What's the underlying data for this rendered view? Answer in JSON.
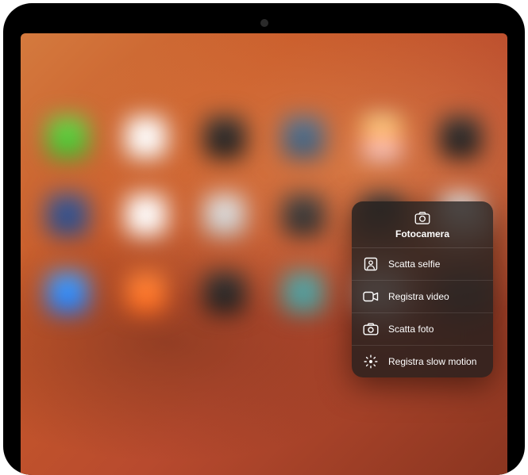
{
  "menu": {
    "title": "Fotocamera",
    "items": [
      {
        "icon": "selfie",
        "label": "Scatta selfie"
      },
      {
        "icon": "video",
        "label": "Registra video"
      },
      {
        "icon": "photo",
        "label": "Scatta foto"
      },
      {
        "icon": "slowmo",
        "label": "Registra slow motion"
      }
    ]
  }
}
